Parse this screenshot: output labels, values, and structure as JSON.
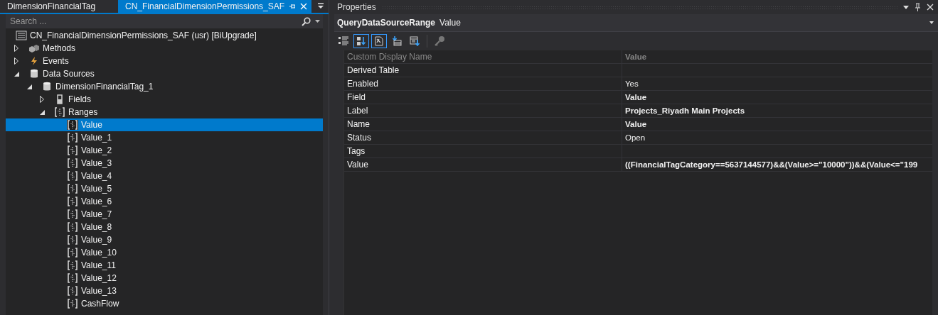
{
  "tabs": [
    {
      "label": "DimensionFinancialTag",
      "selected": false
    },
    {
      "label": "CN_FinancialDimensionPermissions_SAF",
      "selected": true
    }
  ],
  "search": {
    "placeholder": "Search ..."
  },
  "tree": [
    {
      "label": "CN_FinancialDimensionPermissions_SAF (usr) [BiUpgrade]",
      "kind": "form",
      "selected": false,
      "children": [
        {
          "label": "Methods",
          "kind": "methods",
          "expanded": false,
          "selected": false
        },
        {
          "label": "Events",
          "kind": "events",
          "expanded": false,
          "selected": false
        },
        {
          "label": "Data Sources",
          "kind": "datasource",
          "expanded": true,
          "selected": false,
          "children": [
            {
              "label": "DimensionFinancialTag_1",
              "kind": "datasource",
              "expanded": true,
              "selected": false,
              "children": [
                {
                  "label": "Fields",
                  "kind": "fields",
                  "expanded": false,
                  "selected": false
                },
                {
                  "label": "Ranges",
                  "kind": "range",
                  "expanded": true,
                  "selected": false,
                  "children": [
                    {
                      "label": "Value",
                      "kind": "range",
                      "selected": true
                    },
                    {
                      "label": "Value_1",
                      "kind": "range",
                      "selected": false
                    },
                    {
                      "label": "Value_2",
                      "kind": "range",
                      "selected": false
                    },
                    {
                      "label": "Value_3",
                      "kind": "range",
                      "selected": false
                    },
                    {
                      "label": "Value_4",
                      "kind": "range",
                      "selected": false
                    },
                    {
                      "label": "Value_5",
                      "kind": "range",
                      "selected": false
                    },
                    {
                      "label": "Value_6",
                      "kind": "range",
                      "selected": false
                    },
                    {
                      "label": "Value_7",
                      "kind": "range",
                      "selected": false
                    },
                    {
                      "label": "Value_8",
                      "kind": "range",
                      "selected": false
                    },
                    {
                      "label": "Value_9",
                      "kind": "range",
                      "selected": false
                    },
                    {
                      "label": "Value_10",
                      "kind": "range",
                      "selected": false
                    },
                    {
                      "label": "Value_11",
                      "kind": "range",
                      "selected": false
                    },
                    {
                      "label": "Value_12",
                      "kind": "range",
                      "selected": false
                    },
                    {
                      "label": "Value_13",
                      "kind": "range",
                      "selected": false
                    },
                    {
                      "label": "CashFlow",
                      "kind": "range",
                      "selected": false
                    }
                  ]
                }
              ]
            }
          ]
        }
      ]
    }
  ],
  "properties": {
    "title": "Properties",
    "object_type": "QueryDataSourceRange",
    "object_name": "Value",
    "toolbar": [
      {
        "kind": "categorized",
        "selected": false
      },
      {
        "kind": "alphabetical",
        "selected": true
      },
      {
        "kind": "properties",
        "selected": true
      },
      {
        "kind": "events-load",
        "selected": false
      },
      {
        "kind": "events-save",
        "selected": false
      },
      {
        "kind": "key",
        "selected": false
      }
    ],
    "columns": [
      "Custom Display Name",
      "Value"
    ],
    "rows": [
      {
        "name": "Derived Table"
      },
      {
        "name": "Enabled",
        "value": "Yes",
        "bold": false
      },
      {
        "name": "Field",
        "value": "Value",
        "bold": true
      },
      {
        "name": "Label",
        "value": "Projects_Riyadh Main Projects",
        "bold": true
      },
      {
        "name": "Name",
        "value": "Value",
        "bold": true
      },
      {
        "name": "Status",
        "value": "Open",
        "bold": false
      },
      {
        "name": "Tags"
      },
      {
        "name": "Value",
        "value": "((FinancialTagCategory==5637144577)&&(Value>=\"10000\"))&&(Value<=\"199",
        "bold": true
      }
    ]
  }
}
